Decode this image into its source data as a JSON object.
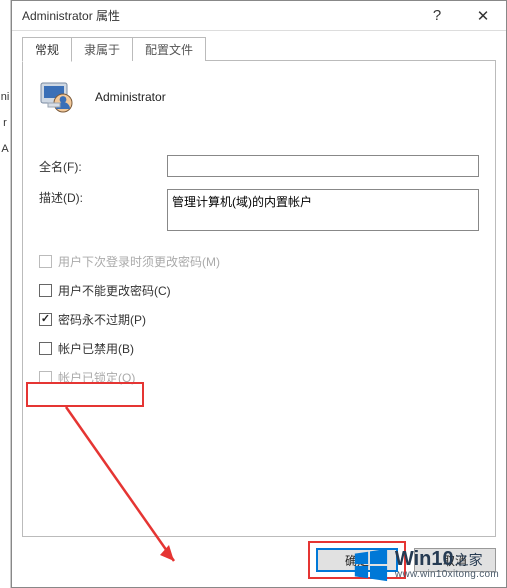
{
  "titlebar": {
    "title": "Administrator 属性",
    "help": "?",
    "close": "✕"
  },
  "tabs": {
    "general": "常规",
    "member_of": "隶属于",
    "profile": "配置文件"
  },
  "header": {
    "username": "Administrator"
  },
  "fields": {
    "fullname_label": "全名(F):",
    "fullname_value": "",
    "description_label": "描述(D):",
    "description_value": "管理计算机(域)的内置帐户"
  },
  "checks": {
    "must_change": "用户下次登录时须更改密码(M)",
    "cannot_change": "用户不能更改密码(C)",
    "never_expires": "密码永不过期(P)",
    "disabled": "帐户已禁用(B)",
    "locked": "帐户已锁定(O)"
  },
  "buttons": {
    "ok": "确定",
    "cancel": "取消"
  },
  "watermark": {
    "brand_main": "Win10",
    "brand_suffix": "之家",
    "url": "www.win10xitong.com"
  },
  "left_strip": {
    "a": "ni",
    "b": "r",
    "c": "A"
  }
}
